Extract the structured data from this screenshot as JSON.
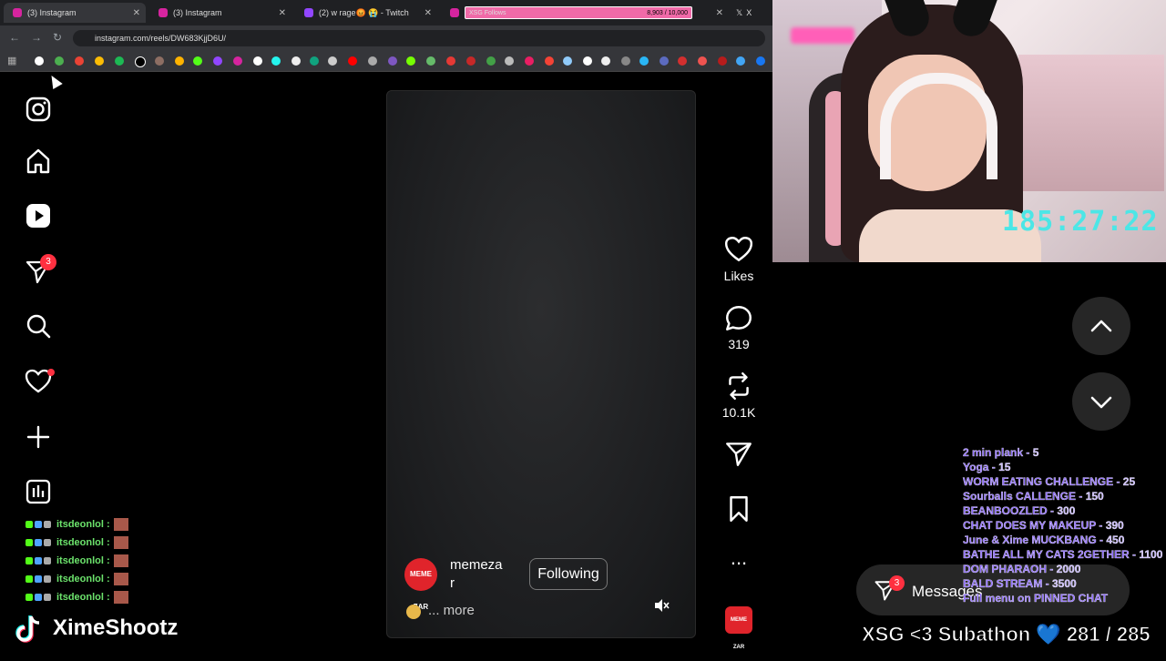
{
  "browser": {
    "tabs": [
      {
        "title": "(3) Instagram",
        "active": true
      },
      {
        "title": "(3) Instagram",
        "active": false
      },
      {
        "title": "(2) w rage😡 😭 - Twitch",
        "active": false
      },
      {
        "title": "XSG Follows",
        "active": false,
        "progress_text": "8,903 / 10,000",
        "progress": 0.89
      },
      {
        "title": "X",
        "active": false
      }
    ],
    "url": "instagram.com/reels/DW683KjjD6U/"
  },
  "instagram": {
    "notification_badge": "3",
    "reel": {
      "username": "memeza r",
      "username_line1": "memeza",
      "username_line2": "r",
      "avatar_text": "MEME ZAR",
      "follow_label": "Following",
      "caption_more": "... more"
    },
    "actions": {
      "likes_label": "Likes",
      "comments": "319",
      "reposts": "10.1K",
      "more": "..."
    },
    "messages": {
      "label": "Messages",
      "badge": "3"
    }
  },
  "chat": {
    "lines": [
      {
        "user": "itsdeonlol :"
      },
      {
        "user": "itsdeonlol :"
      },
      {
        "user": "itsdeonlol :"
      },
      {
        "user": "itsdeonlol :"
      },
      {
        "user": "itsdeonlol :"
      }
    ]
  },
  "stream": {
    "tiktok_name": "XimeShootz",
    "timer": "185:27:22",
    "subathon": "XSG <3 Subathon 💙  281 / 285",
    "menu": [
      {
        "item": "2 min plank",
        "price": "5"
      },
      {
        "item": "Yoga",
        "price": "15"
      },
      {
        "item": "WORM EATING CHALLENGE",
        "price": "25"
      },
      {
        "item": "Sourballs CALLENGE",
        "price": "150"
      },
      {
        "item": "BEANBOOZLED",
        "price": "300"
      },
      {
        "item": "CHAT DOES MY MAKEUP",
        "price": "390"
      },
      {
        "item": "June & Xime MUCKBANG",
        "price": "450"
      },
      {
        "item": "BATHE ALL MY CATS 2GETHER",
        "price": "1100"
      },
      {
        "item": "DOM PHARAOH",
        "price": "2000"
      },
      {
        "item": "BALD STREAM",
        "price": "3500"
      }
    ],
    "menu_footer": "Full menu on PINNED CHAT"
  }
}
